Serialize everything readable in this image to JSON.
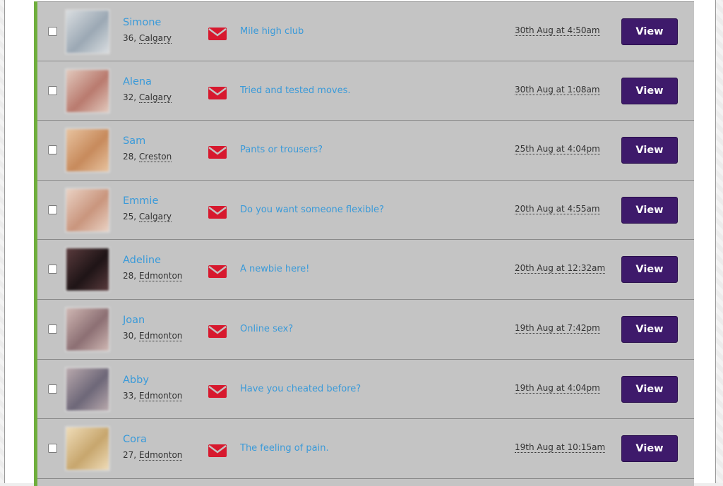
{
  "colors": {
    "accent_bar": "#6fae3c",
    "row_bg": "#c4c4c4",
    "link": "#3a9ad9",
    "mail_icon": "#d7192e",
    "view_button": "#3e1a6b"
  },
  "messages": [
    {
      "name": "Simone",
      "age": "36",
      "city": "Calgary",
      "subject": "Mile high club",
      "date": "30th Aug at 4:50am",
      "action": "View",
      "icon": "envelope-icon",
      "avatar_colors": [
        "#9ba8b4",
        "#d9dde0"
      ]
    },
    {
      "name": "Alena",
      "age": "32",
      "city": "Calgary",
      "subject": "Tried and tested moves.",
      "date": "30th Aug at 1:08am",
      "action": "View",
      "icon": "envelope-icon",
      "avatar_colors": [
        "#b97a6e",
        "#e2c9bd"
      ]
    },
    {
      "name": "Sam",
      "age": "28",
      "city": "Creston",
      "subject": "Pants or trousers?",
      "date": "25th Aug at 4:04pm",
      "action": "View",
      "icon": "envelope-icon",
      "avatar_colors": [
        "#c78a5c",
        "#e8c39f"
      ]
    },
    {
      "name": "Emmie",
      "age": "25",
      "city": "Calgary",
      "subject": "Do you want someone flexible?",
      "date": "20th Aug at 4:55am",
      "action": "View",
      "icon": "envelope-icon",
      "avatar_colors": [
        "#c9957d",
        "#ead2c4"
      ]
    },
    {
      "name": "Adeline",
      "age": "28",
      "city": "Edmonton",
      "subject": "A newbie here!",
      "date": "20th Aug at 12:32am",
      "action": "View",
      "icon": "envelope-icon",
      "avatar_colors": [
        "#1e1416",
        "#5a3b3d"
      ]
    },
    {
      "name": "Joan",
      "age": "30",
      "city": "Edmonton",
      "subject": "Online sex?",
      "date": "19th Aug at 7:42pm",
      "action": "View",
      "icon": "envelope-icon",
      "avatar_colors": [
        "#8c6f73",
        "#cfb7b3"
      ]
    },
    {
      "name": "Abby",
      "age": "33",
      "city": "Edmonton",
      "subject": "Have you cheated before?",
      "date": "19th Aug at 4:04pm",
      "action": "View",
      "icon": "envelope-icon",
      "avatar_colors": [
        "#6d6778",
        "#b9a9ad"
      ]
    },
    {
      "name": "Cora",
      "age": "27",
      "city": "Edmonton",
      "subject": "The feeling of pain.",
      "date": "19th Aug at 10:15am",
      "action": "View",
      "icon": "envelope-icon",
      "avatar_colors": [
        "#c7a66d",
        "#efdcb8"
      ]
    }
  ]
}
